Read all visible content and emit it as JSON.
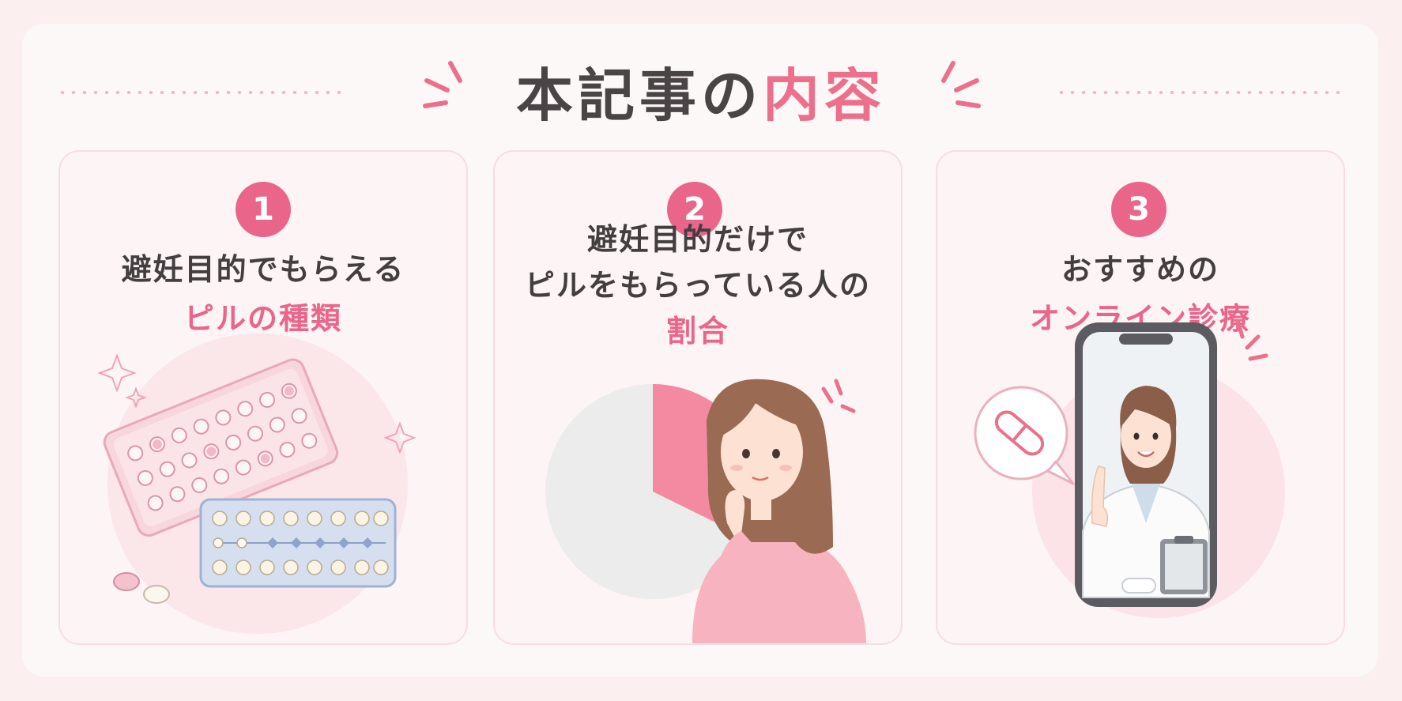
{
  "heading": {
    "part1": "本記事の",
    "part2": "内容"
  },
  "colors": {
    "accent": "#e9668a",
    "text_dark": "#433f41",
    "background": "#fcefef"
  },
  "cards": [
    {
      "number": "1",
      "line1": "避妊目的でもらえる",
      "highlight": "ピルの種類",
      "illustration": "pill-packs-illustration"
    },
    {
      "number": "2",
      "line1": "避妊目的だけで",
      "line2": "ピルをもらっている人の",
      "highlight": "割合",
      "illustration": "pie-and-thinking-woman-illustration"
    },
    {
      "number": "3",
      "line1": "おすすめの",
      "highlight": "オンライン診療",
      "illustration": "doctor-on-smartphone-illustration"
    }
  ]
}
